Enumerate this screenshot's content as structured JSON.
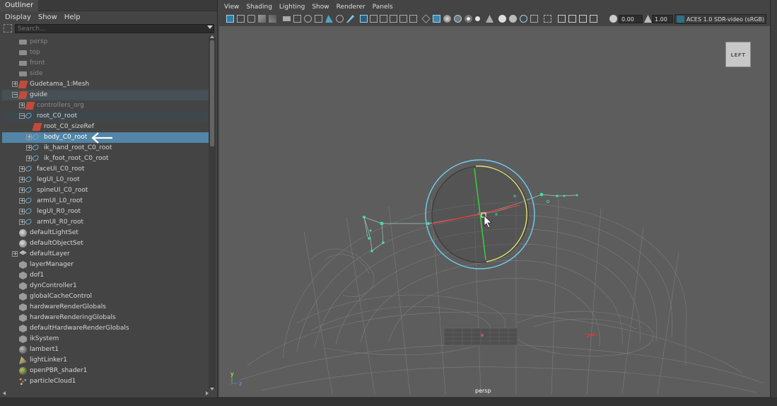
{
  "outliner": {
    "title": "Outliner",
    "menus": [
      "Display",
      "Show",
      "Help"
    ],
    "search_placeholder": "Search...",
    "items": [
      {
        "label": "persp",
        "indent": 1,
        "icon": "camera-icon",
        "dim": true
      },
      {
        "label": "top",
        "indent": 1,
        "icon": "camera-icon",
        "dim": true
      },
      {
        "label": "front",
        "indent": 1,
        "icon": "camera-icon",
        "dim": true
      },
      {
        "label": "side",
        "indent": 1,
        "icon": "camera-icon",
        "dim": true
      },
      {
        "label": "Gudetama_1:Mesh",
        "indent": 1,
        "icon": "mesh-transform-icon",
        "expand": "+"
      },
      {
        "label": "guide",
        "indent": 1,
        "icon": "mesh-transform-icon",
        "expand": "-",
        "state": "hl"
      },
      {
        "label": "controllers_org",
        "indent": 2,
        "icon": "mesh-transform-icon",
        "expand": "+",
        "dim": true
      },
      {
        "label": "root_C0_root",
        "indent": 2,
        "icon": "curve-icon",
        "expand": "-",
        "state": "hl2"
      },
      {
        "label": "root_C0_sizeRef",
        "indent": 3,
        "icon": "mesh-transform-icon"
      },
      {
        "label": "body_C0_root",
        "indent": 3,
        "icon": "curve-icon",
        "expand": "+",
        "state": "sel"
      },
      {
        "label": "ik_hand_root_C0_root",
        "indent": 3,
        "icon": "curve-icon",
        "expand": "+"
      },
      {
        "label": "ik_foot_root_C0_root",
        "indent": 3,
        "icon": "curve-icon",
        "expand": "+"
      },
      {
        "label": "faceUI_C0_root",
        "indent": 2,
        "icon": "curve-icon",
        "expand": "+"
      },
      {
        "label": "legUI_L0_root",
        "indent": 2,
        "icon": "curve-icon",
        "expand": "+"
      },
      {
        "label": "spineUI_C0_root",
        "indent": 2,
        "icon": "curve-icon",
        "expand": "+"
      },
      {
        "label": "armUI_L0_root",
        "indent": 2,
        "icon": "curve-icon",
        "expand": "+"
      },
      {
        "label": "legUI_R0_root",
        "indent": 2,
        "icon": "curve-icon",
        "expand": "+"
      },
      {
        "label": "armUI_R0_root",
        "indent": 2,
        "icon": "curve-icon",
        "expand": "+"
      },
      {
        "label": "defaultLightSet",
        "indent": 1,
        "icon": "set-icon"
      },
      {
        "label": "defaultObjectSet",
        "indent": 1,
        "icon": "set-icon"
      },
      {
        "label": "defaultLayer",
        "indent": 1,
        "icon": "layer-icon",
        "expand": "+"
      },
      {
        "label": "layerManager",
        "indent": 1,
        "icon": "node-icon"
      },
      {
        "label": "dof1",
        "indent": 1,
        "icon": "node-icon"
      },
      {
        "label": "dynController1",
        "indent": 1,
        "icon": "node-icon"
      },
      {
        "label": "globalCacheControl",
        "indent": 1,
        "icon": "node-icon"
      },
      {
        "label": "hardwareRenderGlobals",
        "indent": 1,
        "icon": "node-icon"
      },
      {
        "label": "hardwareRenderingGlobals",
        "indent": 1,
        "icon": "node-icon"
      },
      {
        "label": "defaultHardwareRenderGlobals",
        "indent": 1,
        "icon": "node-icon"
      },
      {
        "label": "ikSystem",
        "indent": 1,
        "icon": "node-icon"
      },
      {
        "label": "lambert1",
        "indent": 1,
        "icon": "lambert-shader-icon"
      },
      {
        "label": "lightLinker1",
        "indent": 1,
        "icon": "light-linker-icon"
      },
      {
        "label": "openPBR_shader1",
        "indent": 1,
        "icon": "pbr-shader-icon"
      },
      {
        "label": "particleCloud1",
        "indent": 1,
        "icon": "particle-icon"
      }
    ]
  },
  "viewport": {
    "menus": [
      "View",
      "Shading",
      "Lighting",
      "Show",
      "Renderer",
      "Panels"
    ],
    "exposure_value": "0.00",
    "gamma_value": "1.00",
    "color_space": "ACES 1.0 SDR-video (sRGB)",
    "viewcube_label": "LEFT",
    "camera_label": "persp",
    "axis_labels": {
      "y": "y",
      "z": "z"
    }
  },
  "colors": {
    "selection": "#5285a6",
    "viewport_bg": "#5d5d5d",
    "guide_green": "#41e0a0",
    "gizmo_blue": "#6ecff0",
    "gizmo_yellow": "#e4e472"
  }
}
